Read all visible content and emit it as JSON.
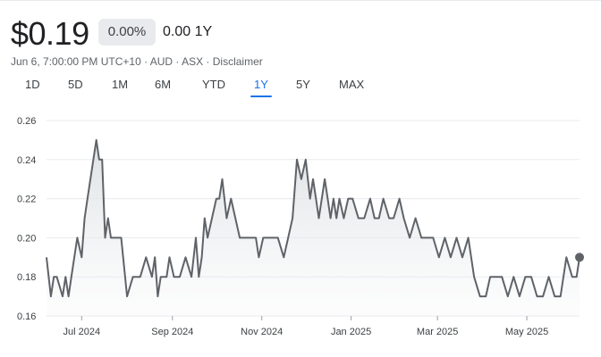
{
  "quote": {
    "price": "$0.19",
    "change_pct": "0.00%",
    "change_abs": "0.00 1Y"
  },
  "meta_line": "Jun 6, 7:00:00 PM UTC+10 · AUD · ASX · Disclaimer",
  "range_tabs": [
    {
      "label": "1D"
    },
    {
      "label": "5D"
    },
    {
      "label": "1M"
    },
    {
      "label": "6M"
    },
    {
      "label": "YTD"
    },
    {
      "label": "1Y",
      "active": true
    },
    {
      "label": "5Y"
    },
    {
      "label": "MAX"
    }
  ],
  "colors": {
    "line": "#5f6368",
    "accent": "#1a73e8",
    "grid": "#e8eaed"
  },
  "chart_data": {
    "type": "area",
    "y_ticks": [
      0.16,
      0.18,
      0.2,
      0.22,
      0.24,
      0.26
    ],
    "y_tick_labels": [
      "0.16",
      "0.18",
      "0.20",
      "0.22",
      "0.24",
      "0.26"
    ],
    "ylim": [
      0.16,
      0.26
    ],
    "x_tick_labels": [
      "Jul 2024",
      "Sep 2024",
      "Nov 2024",
      "Jan 2025",
      "Mar 2025",
      "May 2025"
    ],
    "x_tick_dates": [
      "2024-07-01",
      "2024-09-01",
      "2024-11-01",
      "2025-01-01",
      "2025-03-01",
      "2025-05-01"
    ],
    "xlim": [
      "2024-06-07",
      "2025-06-06"
    ],
    "grid": true,
    "series": [
      {
        "x": [
          "2024-06-07",
          "2024-06-10",
          "2024-06-12",
          "2024-06-14",
          "2024-06-18",
          "2024-06-20",
          "2024-06-22",
          "2024-06-24",
          "2024-06-26",
          "2024-06-28",
          "2024-07-01",
          "2024-07-03",
          "2024-07-05",
          "2024-07-07",
          "2024-07-09",
          "2024-07-11",
          "2024-07-13",
          "2024-07-15",
          "2024-07-17",
          "2024-07-19",
          "2024-07-21",
          "2024-07-23",
          "2024-07-25",
          "2024-07-28",
          "2024-08-01",
          "2024-08-05",
          "2024-08-08",
          "2024-08-10",
          "2024-08-14",
          "2024-08-18",
          "2024-08-20",
          "2024-08-22",
          "2024-08-24",
          "2024-08-28",
          "2024-08-30",
          "2024-09-02",
          "2024-09-06",
          "2024-09-10",
          "2024-09-14",
          "2024-09-17",
          "2024-09-19",
          "2024-09-21",
          "2024-09-23",
          "2024-09-25",
          "2024-09-28",
          "2024-10-01",
          "2024-10-03",
          "2024-10-05",
          "2024-10-08",
          "2024-10-11",
          "2024-10-14",
          "2024-10-17",
          "2024-10-20",
          "2024-10-23",
          "2024-10-25",
          "2024-10-28",
          "2024-10-30",
          "2024-11-02",
          "2024-11-05",
          "2024-11-08",
          "2024-11-12",
          "2024-11-16",
          "2024-11-19",
          "2024-11-22",
          "2024-11-25",
          "2024-11-28",
          "2024-12-01",
          "2024-12-04",
          "2024-12-06",
          "2024-12-08",
          "2024-12-10",
          "2024-12-12",
          "2024-12-14",
          "2024-12-16",
          "2024-12-18",
          "2024-12-20",
          "2024-12-22",
          "2024-12-24",
          "2024-12-27",
          "2024-12-30",
          "2025-01-02",
          "2025-01-06",
          "2025-01-10",
          "2025-01-14",
          "2025-01-17",
          "2025-01-20",
          "2025-01-23",
          "2025-01-27",
          "2025-01-30",
          "2025-02-03",
          "2025-02-06",
          "2025-02-10",
          "2025-02-14",
          "2025-02-18",
          "2025-02-22",
          "2025-02-26",
          "2025-03-02",
          "2025-03-06",
          "2025-03-10",
          "2025-03-14",
          "2025-03-18",
          "2025-03-22",
          "2025-03-26",
          "2025-03-30",
          "2025-04-03",
          "2025-04-06",
          "2025-04-10",
          "2025-04-14",
          "2025-04-18",
          "2025-04-22",
          "2025-04-26",
          "2025-04-30",
          "2025-05-04",
          "2025-05-08",
          "2025-05-12",
          "2025-05-16",
          "2025-05-20",
          "2025-05-24",
          "2025-05-28",
          "2025-06-01",
          "2025-06-04",
          "2025-06-06"
        ],
        "y": [
          0.19,
          0.17,
          0.18,
          0.18,
          0.17,
          0.18,
          0.17,
          0.18,
          0.19,
          0.2,
          0.19,
          0.21,
          0.22,
          0.23,
          0.24,
          0.25,
          0.24,
          0.24,
          0.2,
          0.21,
          0.2,
          0.2,
          0.2,
          0.2,
          0.17,
          0.18,
          0.18,
          0.18,
          0.19,
          0.18,
          0.19,
          0.17,
          0.18,
          0.18,
          0.19,
          0.18,
          0.18,
          0.19,
          0.18,
          0.2,
          0.18,
          0.19,
          0.21,
          0.2,
          0.21,
          0.22,
          0.22,
          0.23,
          0.21,
          0.22,
          0.21,
          0.2,
          0.2,
          0.2,
          0.2,
          0.2,
          0.19,
          0.2,
          0.2,
          0.2,
          0.2,
          0.19,
          0.2,
          0.21,
          0.24,
          0.23,
          0.24,
          0.22,
          0.23,
          0.22,
          0.21,
          0.22,
          0.23,
          0.22,
          0.21,
          0.22,
          0.21,
          0.22,
          0.21,
          0.22,
          0.22,
          0.21,
          0.21,
          0.22,
          0.21,
          0.21,
          0.22,
          0.21,
          0.21,
          0.22,
          0.21,
          0.2,
          0.21,
          0.2,
          0.2,
          0.2,
          0.19,
          0.2,
          0.19,
          0.2,
          0.19,
          0.2,
          0.18,
          0.17,
          0.17,
          0.18,
          0.18,
          0.18,
          0.17,
          0.18,
          0.17,
          0.18,
          0.18,
          0.17,
          0.17,
          0.18,
          0.17,
          0.17,
          0.19,
          0.18,
          0.18,
          0.19
        ],
        "end_marker": true
      }
    ]
  }
}
